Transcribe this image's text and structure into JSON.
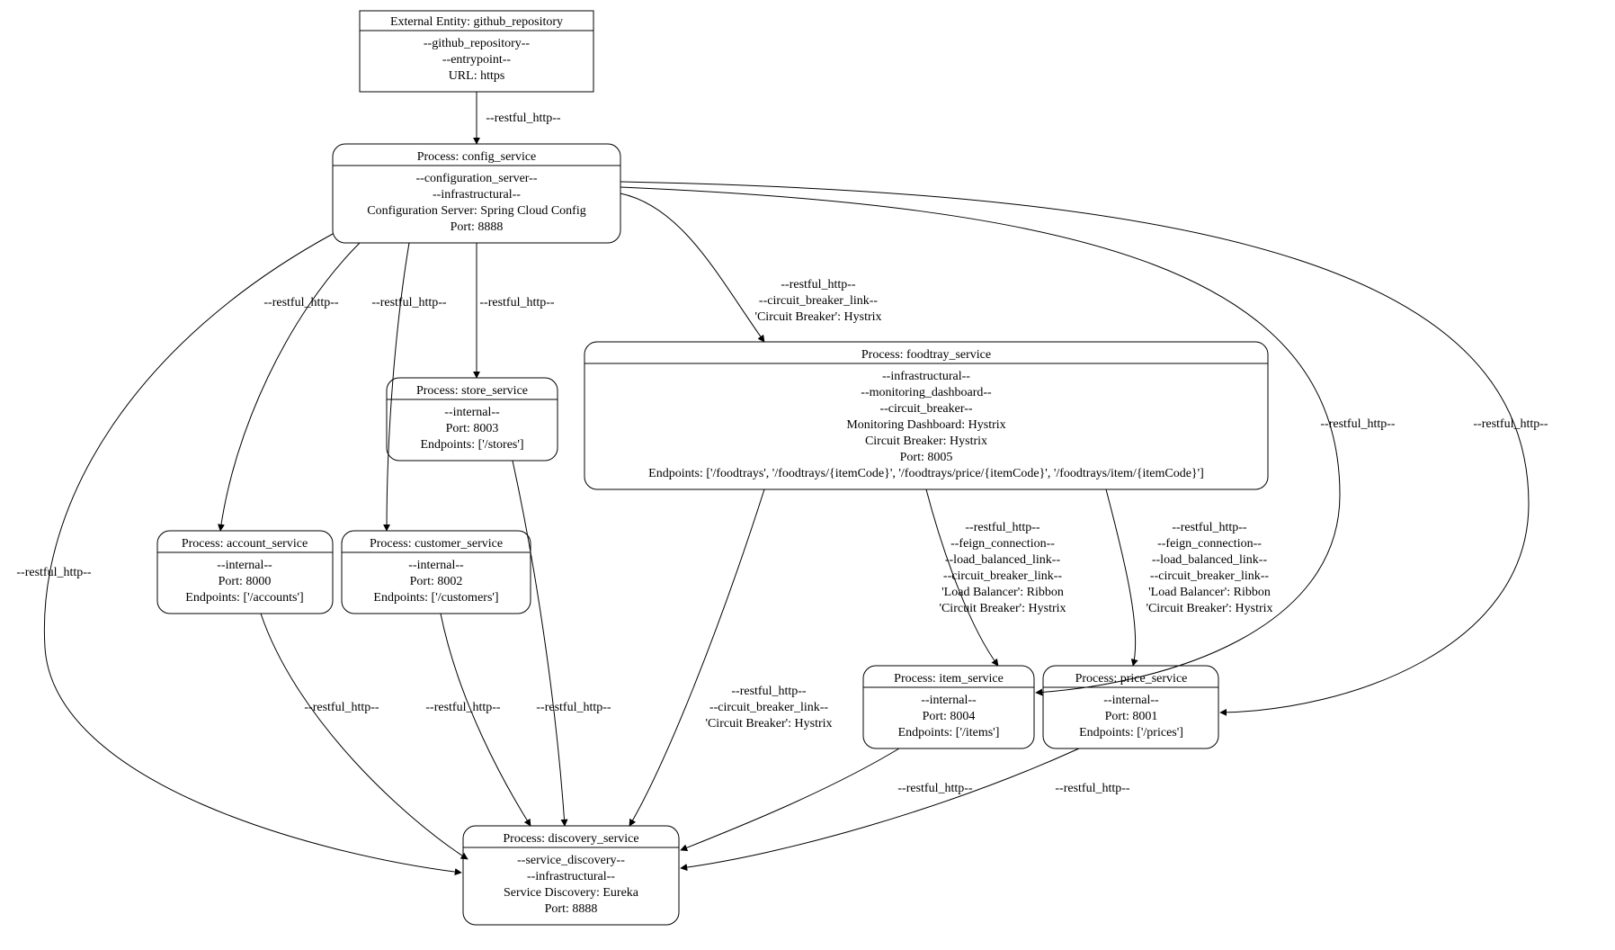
{
  "nodes": {
    "github_repository": {
      "title": "External Entity: github_repository",
      "lines": [
        "--github_repository--",
        "--entrypoint--",
        "URL: https"
      ]
    },
    "config_service": {
      "title": "Process: config_service",
      "lines": [
        "--configuration_server--",
        "--infrastructural--",
        "Configuration Server: Spring Cloud Config",
        "Port: 8888"
      ]
    },
    "store_service": {
      "title": "Process: store_service",
      "lines": [
        "--internal--",
        "Port: 8003",
        "Endpoints: ['/stores']"
      ]
    },
    "foodtray_service": {
      "title": "Process: foodtray_service",
      "lines": [
        "--infrastructural--",
        "--monitoring_dashboard--",
        "--circuit_breaker--",
        "Monitoring Dashboard: Hystrix",
        "Circuit Breaker: Hystrix",
        "Port: 8005",
        "Endpoints: ['/foodtrays', '/foodtrays/{itemCode}', '/foodtrays/price/{itemCode}', '/foodtrays/item/{itemCode}']"
      ]
    },
    "account_service": {
      "title": "Process: account_service",
      "lines": [
        "--internal--",
        "Port: 8000",
        "Endpoints: ['/accounts']"
      ]
    },
    "customer_service": {
      "title": "Process: customer_service",
      "lines": [
        "--internal--",
        "Port: 8002",
        "Endpoints: ['/customers']"
      ]
    },
    "item_service": {
      "title": "Process: item_service",
      "lines": [
        "--internal--",
        "Port: 8004",
        "Endpoints: ['/items']"
      ]
    },
    "price_service": {
      "title": "Process: price_service",
      "lines": [
        "--internal--",
        "Port: 8001",
        "Endpoints: ['/prices']"
      ]
    },
    "discovery_service": {
      "title": "Process: discovery_service",
      "lines": [
        "--service_discovery--",
        "--infrastructural--",
        "Service Discovery: Eureka",
        "Port: 8888"
      ]
    }
  },
  "edges": {
    "e1": {
      "lines": [
        "--restful_http--"
      ]
    },
    "e2": {
      "lines": [
        "--restful_http--"
      ]
    },
    "e3": {
      "lines": [
        "--restful_http--"
      ]
    },
    "e4": {
      "lines": [
        "--restful_http--"
      ]
    },
    "e5": {
      "lines": [
        "--restful_http--",
        "--circuit_breaker_link--",
        "'Circuit Breaker': Hystrix"
      ]
    },
    "e6": {
      "lines": [
        "--restful_http--"
      ]
    },
    "e7": {
      "lines": [
        "--restful_http--"
      ]
    },
    "e8": {
      "lines": [
        "--restful_http--"
      ]
    },
    "e9": {
      "lines": [
        "--restful_http--",
        "--feign_connection--",
        "--load_balanced_link--",
        "--circuit_breaker_link--",
        "'Load Balancer': Ribbon",
        "'Circuit Breaker': Hystrix"
      ]
    },
    "e10": {
      "lines": [
        "--restful_http--",
        "--feign_connection--",
        "--load_balanced_link--",
        "--circuit_breaker_link--",
        "'Load Balancer': Ribbon",
        "'Circuit Breaker': Hystrix"
      ]
    },
    "e11": {
      "lines": [
        "--restful_http--"
      ]
    },
    "e12": {
      "lines": [
        "--restful_http--"
      ]
    },
    "e13": {
      "lines": [
        "--restful_http--"
      ]
    },
    "e14": {
      "lines": [
        "--restful_http--",
        "--circuit_breaker_link--",
        "'Circuit Breaker': Hystrix"
      ]
    },
    "e15": {
      "lines": [
        "--restful_http--"
      ]
    },
    "e16": {
      "lines": [
        "--restful_http--"
      ]
    }
  }
}
